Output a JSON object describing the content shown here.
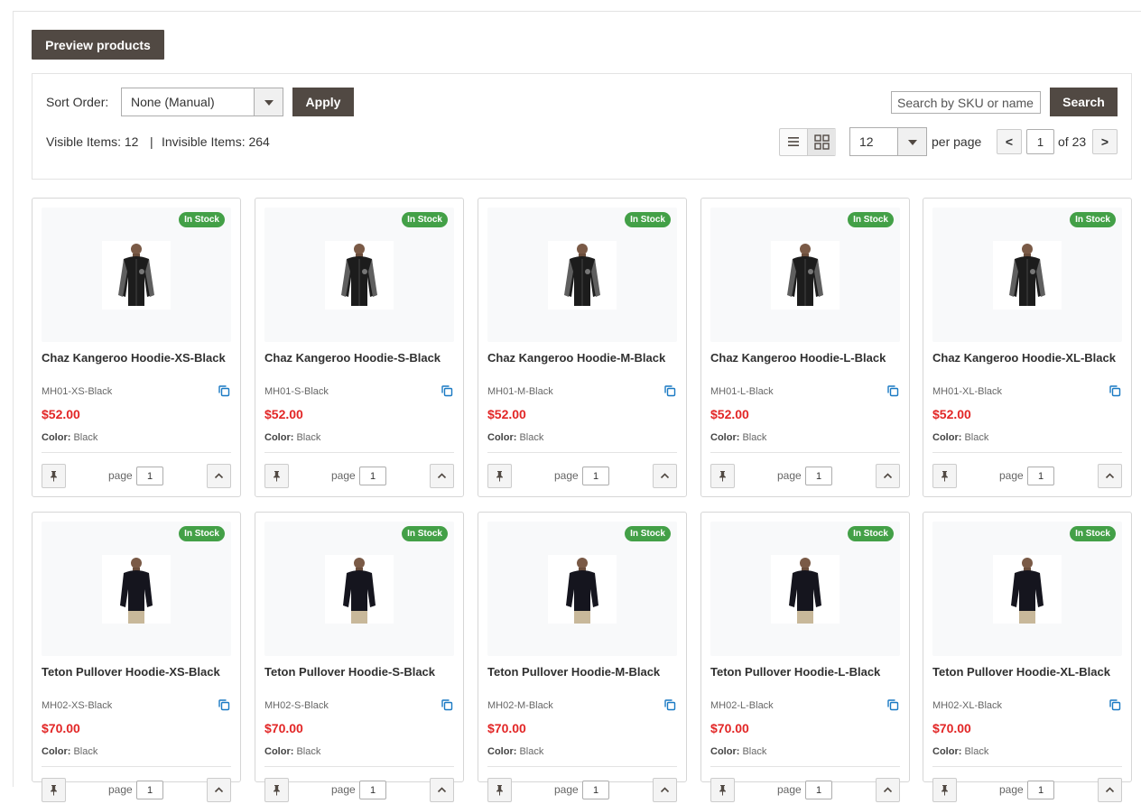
{
  "header": {
    "preview_label": "Preview products"
  },
  "toolbar": {
    "sort_label": "Sort Order:",
    "sort_value": "None (Manual)",
    "apply_label": "Apply",
    "search_placeholder": "Search by SKU or name",
    "search_label": "Search",
    "visible_items": "Visible Items: 12",
    "separator": "|",
    "invisible_items": "Invisible Items: 264",
    "view_mode": "grid",
    "per_page_value": "12",
    "per_page_label": "per page",
    "prev_label": "<",
    "page_value": "1",
    "of_pages": "of 23",
    "next_label": ">"
  },
  "products": [
    {
      "name": "Chaz Kangeroo Hoodie-XS-Black",
      "sku": "MH01-XS-Black",
      "price": "$52.00",
      "color_label": "Color:",
      "color": "Black",
      "stock": "In Stock",
      "page_label": "page",
      "page": "1"
    },
    {
      "name": "Chaz Kangeroo Hoodie-S-Black",
      "sku": "MH01-S-Black",
      "price": "$52.00",
      "color_label": "Color:",
      "color": "Black",
      "stock": "In Stock",
      "page_label": "page",
      "page": "1"
    },
    {
      "name": "Chaz Kangeroo Hoodie-M-Black",
      "sku": "MH01-M-Black",
      "price": "$52.00",
      "color_label": "Color:",
      "color": "Black",
      "stock": "In Stock",
      "page_label": "page",
      "page": "1"
    },
    {
      "name": "Chaz Kangeroo Hoodie-L-Black",
      "sku": "MH01-L-Black",
      "price": "$52.00",
      "color_label": "Color:",
      "color": "Black",
      "stock": "In Stock",
      "page_label": "page",
      "page": "1"
    },
    {
      "name": "Chaz Kangeroo Hoodie-XL-Black",
      "sku": "MH01-XL-Black",
      "price": "$52.00",
      "color_label": "Color:",
      "color": "Black",
      "stock": "In Stock",
      "page_label": "page",
      "page": "1"
    },
    {
      "name": "Teton Pullover Hoodie-XS-Black",
      "sku": "MH02-XS-Black",
      "price": "$70.00",
      "color_label": "Color:",
      "color": "Black",
      "stock": "In Stock",
      "page_label": "page",
      "page": "1"
    },
    {
      "name": "Teton Pullover Hoodie-S-Black",
      "sku": "MH02-S-Black",
      "price": "$70.00",
      "color_label": "Color:",
      "color": "Black",
      "stock": "In Stock",
      "page_label": "page",
      "page": "1"
    },
    {
      "name": "Teton Pullover Hoodie-M-Black",
      "sku": "MH02-M-Black",
      "price": "$70.00",
      "color_label": "Color:",
      "color": "Black",
      "stock": "In Stock",
      "page_label": "page",
      "page": "1"
    },
    {
      "name": "Teton Pullover Hoodie-L-Black",
      "sku": "MH02-L-Black",
      "price": "$70.00",
      "color_label": "Color:",
      "color": "Black",
      "stock": "In Stock",
      "page_label": "page",
      "page": "1"
    },
    {
      "name": "Teton Pullover Hoodie-XL-Black",
      "sku": "MH02-XL-Black",
      "price": "$70.00",
      "color_label": "Color:",
      "color": "Black",
      "stock": "In Stock",
      "page_label": "page",
      "page": "1"
    }
  ],
  "icons": {
    "pin": "pin-icon",
    "move_up": "chevron-up-icon",
    "copy": "copy-icon",
    "list_view": "list-view-icon",
    "grid_view": "grid-view-icon",
    "dropdown": "chevron-down-icon"
  },
  "colors": {
    "primary_button": "#514943",
    "in_stock": "#43a047",
    "price": "#e22626",
    "copy_icon": "#1979c3"
  }
}
